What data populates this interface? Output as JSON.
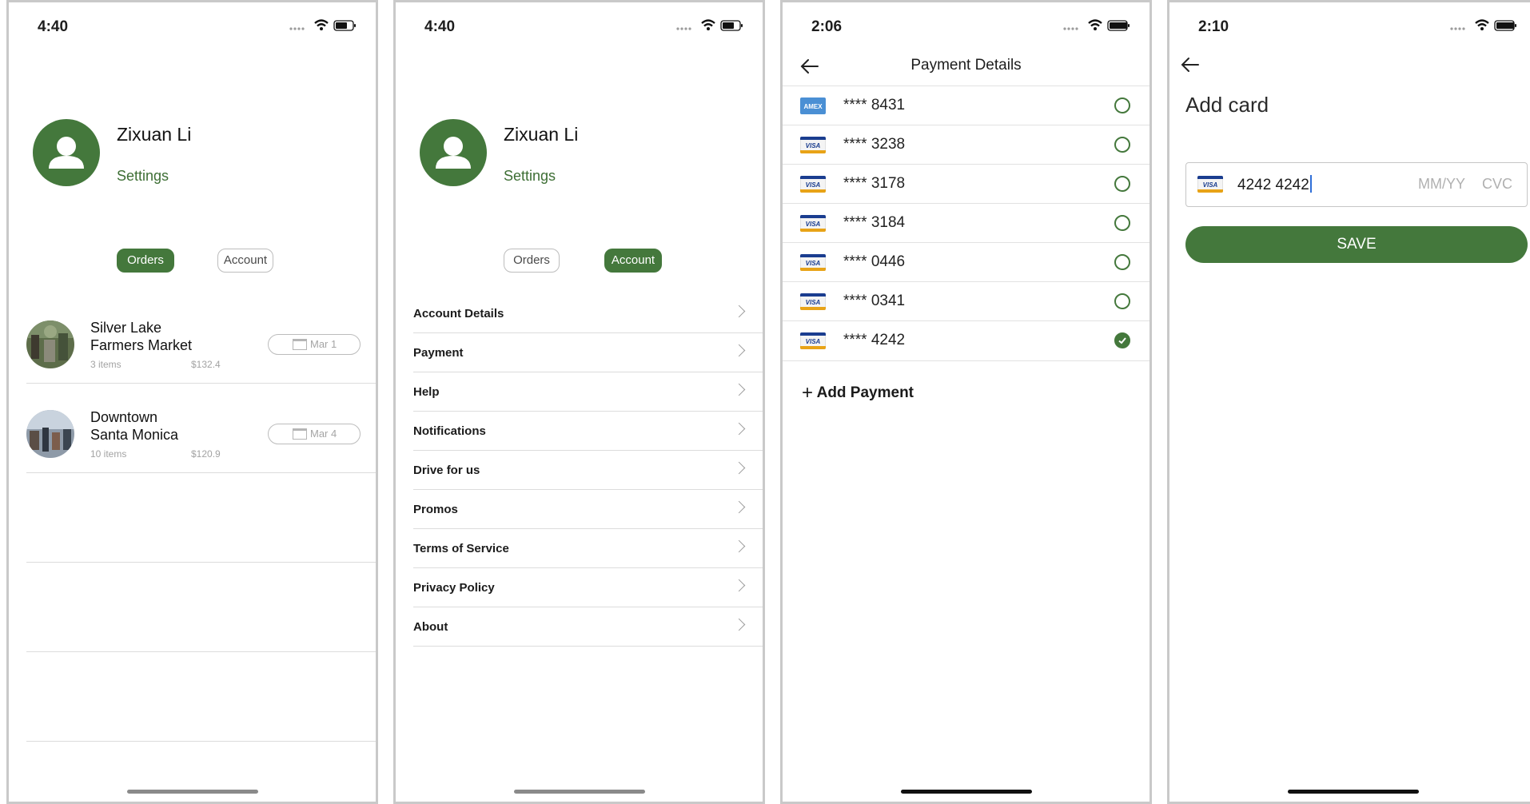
{
  "colors": {
    "brand_green": "#44783c",
    "divider": "#dcdcdc"
  },
  "screen1": {
    "status_time": "4:40",
    "profile": {
      "name": "Zixuan Li",
      "settings": "Settings"
    },
    "tabs": {
      "orders": "Orders",
      "account": "Account",
      "active": "orders"
    },
    "orders": [
      {
        "name_line1": "Silver Lake",
        "name_line2": "Farmers Market",
        "items": "3 items",
        "total": "$132.4",
        "date": "Mar 1"
      },
      {
        "name_line1": "Downtown",
        "name_line2": "Santa Monica",
        "items": "10 items",
        "total": "$120.9",
        "date": "Mar 4"
      }
    ]
  },
  "screen2": {
    "status_time": "4:40",
    "profile": {
      "name": "Zixuan Li",
      "settings": "Settings"
    },
    "tabs": {
      "orders": "Orders",
      "account": "Account",
      "active": "account"
    },
    "menu": [
      "Account Details",
      "Payment",
      "Help",
      "Notifications",
      "Drive for us",
      "Promos",
      "Terms of Service",
      "Privacy Policy",
      "About"
    ]
  },
  "screen3": {
    "status_time": "2:06",
    "title": "Payment Details",
    "cards": [
      {
        "brand": "AMEX",
        "number": "**** 8431",
        "selected": false
      },
      {
        "brand": "VISA",
        "number": "**** 3238",
        "selected": false
      },
      {
        "brand": "VISA",
        "number": "**** 3178",
        "selected": false
      },
      {
        "brand": "VISA",
        "number": "**** 3184",
        "selected": false
      },
      {
        "brand": "VISA",
        "number": "**** 0446",
        "selected": false
      },
      {
        "brand": "VISA",
        "number": "**** 0341",
        "selected": false
      },
      {
        "brand": "VISA",
        "number": "**** 4242",
        "selected": true
      }
    ],
    "add_payment": "Add Payment"
  },
  "screen4": {
    "status_time": "2:10",
    "title": "Add card",
    "card_brand": "VISA",
    "card_number": "4242 4242",
    "expiry_placeholder": "MM/YY",
    "cvc_placeholder": "CVC",
    "save_label": "SAVE"
  }
}
